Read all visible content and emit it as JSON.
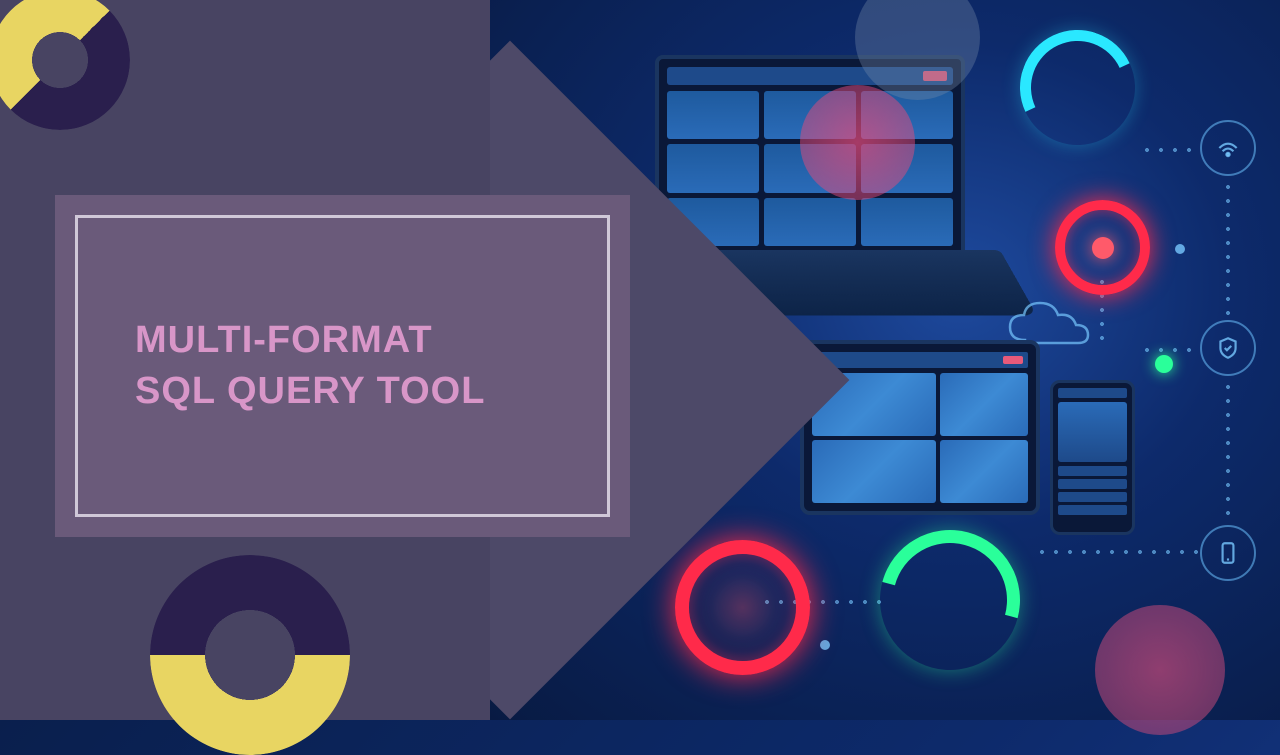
{
  "title": {
    "line1": "MULTI-FORMAT",
    "line2": "SQL QUERY TOOL"
  }
}
